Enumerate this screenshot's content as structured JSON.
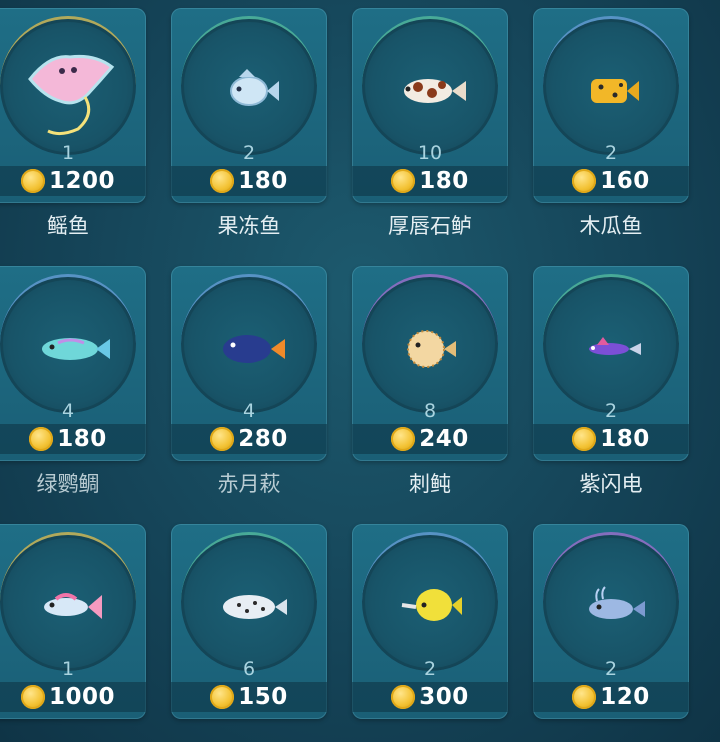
{
  "items": [
    {
      "name": "鳐鱼",
      "count": "1",
      "price": "1200",
      "fish": "manta-ray-icon",
      "ring": "gold"
    },
    {
      "name": "果冻鱼",
      "count": "2",
      "price": "180",
      "fish": "jelly-fish-icon",
      "ring": "green"
    },
    {
      "name": "厚唇石鲈",
      "count": "10",
      "price": "180",
      "fish": "sweetlips-fish-icon",
      "ring": "green"
    },
    {
      "name": "木瓜鱼",
      "count": "2",
      "price": "160",
      "fish": "boxfish-icon",
      "ring": "blue"
    },
    {
      "name": "绿鹦鲷",
      "count": "4",
      "price": "180",
      "fish": "parrotfish-icon",
      "ring": "blue"
    },
    {
      "name": "赤月萩",
      "count": "4",
      "price": "280",
      "fish": "blue-tang-icon",
      "ring": "blue"
    },
    {
      "name": "刺鲀",
      "count": "8",
      "price": "240",
      "fish": "pufferfish-icon",
      "ring": "purple"
    },
    {
      "name": "紫闪电",
      "count": "2",
      "price": "180",
      "fish": "purple-dartfish-icon",
      "ring": "green"
    },
    {
      "name": "",
      "count": "1",
      "price": "1000",
      "fish": "pink-fish-icon",
      "ring": "gold"
    },
    {
      "name": "",
      "count": "6",
      "price": "150",
      "fish": "spotted-fish-icon",
      "ring": "green"
    },
    {
      "name": "",
      "count": "2",
      "price": "300",
      "fish": "butterflyfish-icon",
      "ring": "blue"
    },
    {
      "name": "",
      "count": "2",
      "price": "120",
      "fish": "blue-pill-fish-icon",
      "ring": "purple"
    }
  ],
  "colors": {
    "background": "#154458",
    "card": "#1d6880",
    "coin": "#f3c233"
  }
}
